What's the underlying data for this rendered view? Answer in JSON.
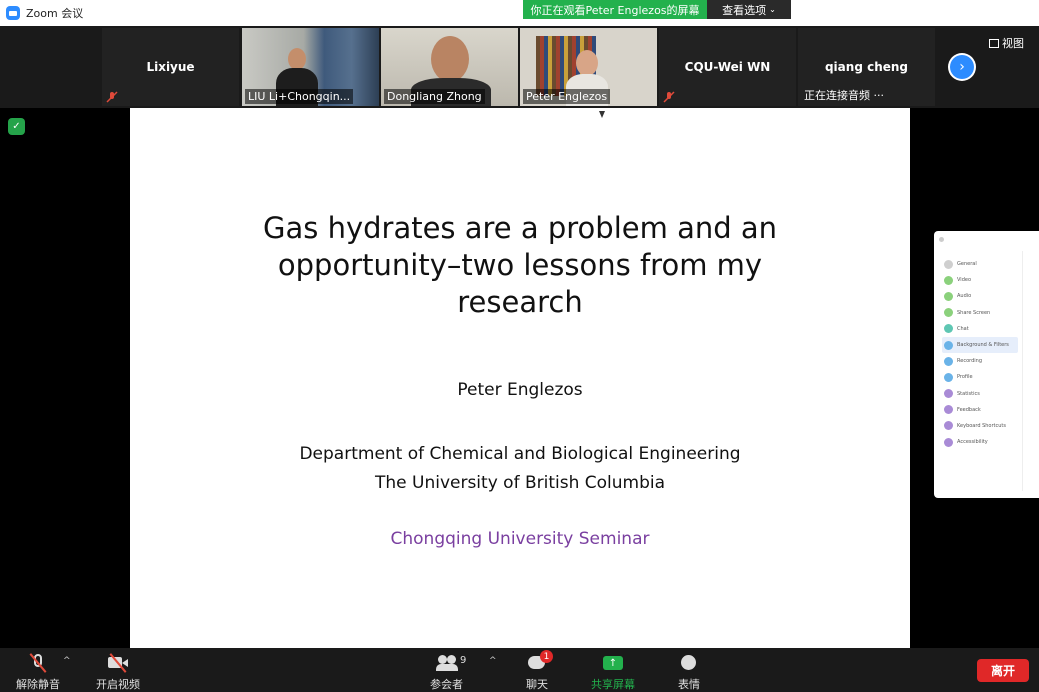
{
  "window": {
    "title": "Zoom 会议"
  },
  "banner": {
    "viewing_text": "你正在观看Peter  Englezos的屏幕",
    "options_label": "查看选项",
    "options_caret": "⌄"
  },
  "view": {
    "label": "视图"
  },
  "participants": [
    {
      "name": "Lixiyue",
      "muted": true,
      "video": false
    },
    {
      "name": "LIU Li+Chongqin...",
      "muted": false,
      "video": true,
      "active": true
    },
    {
      "name": "Dongliang Zhong",
      "muted": false,
      "video": true
    },
    {
      "name": "Peter Englezos",
      "muted": false,
      "video": true
    },
    {
      "name": "CQU-Wei WN",
      "muted": true,
      "video": false
    },
    {
      "name": "qiang cheng",
      "muted": false,
      "video": false,
      "status": "正在连接音频 ···"
    }
  ],
  "slide": {
    "title": "Gas hydrates are a problem and an opportunity–two lessons from my research",
    "author": "Peter Englezos",
    "dept_line1": "Department of Chemical and Biological Engineering",
    "dept_line2": "The University of British Columbia",
    "seminar": "Chongqing University Seminar",
    "seminar_color": "#7a3fa0"
  },
  "settings_panel": {
    "items": [
      {
        "label": "General",
        "color": "#cfcfcf"
      },
      {
        "label": "Video",
        "color": "#8bd17c"
      },
      {
        "label": "Audio",
        "color": "#8bd17c"
      },
      {
        "label": "Share Screen",
        "color": "#8bd17c"
      },
      {
        "label": "Chat",
        "color": "#5fc7b3"
      },
      {
        "label": "Background & Filters",
        "color": "#6ab3e8",
        "selected": true
      },
      {
        "label": "Recording",
        "color": "#6ab3e8"
      },
      {
        "label": "Profile",
        "color": "#6ab3e8"
      },
      {
        "label": "Statistics",
        "color": "#a98bd6"
      },
      {
        "label": "Feedback",
        "color": "#a98bd6"
      },
      {
        "label": "Keyboard Shortcuts",
        "color": "#a98bd6"
      },
      {
        "label": "Accessibility",
        "color": "#a98bd6"
      }
    ]
  },
  "toolbar": {
    "unmute_label": "解除静音",
    "video_label": "开启视频",
    "participants_label": "参会者",
    "participants_count": "9",
    "chat_label": "聊天",
    "chat_badge": "1",
    "share_label": "共享屏幕",
    "reactions_label": "表情",
    "leave_label": "离开",
    "caret": "^"
  },
  "colors": {
    "accent_green": "#23b14d",
    "accent_blue": "#2d8cff",
    "leave_red": "#e02828"
  }
}
